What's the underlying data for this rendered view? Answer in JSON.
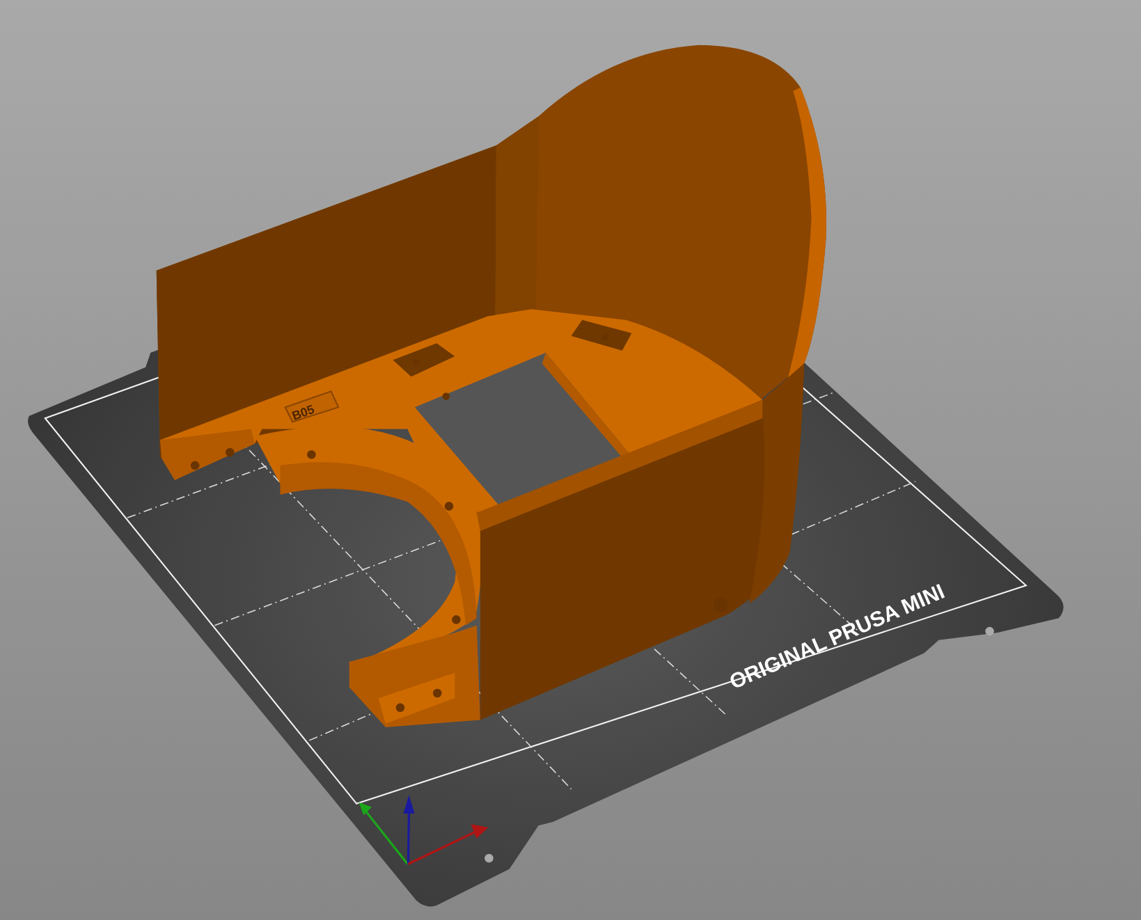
{
  "bed": {
    "label": "ORIGINAL PRUSA MINI"
  },
  "model": {
    "label": "B05"
  }
}
